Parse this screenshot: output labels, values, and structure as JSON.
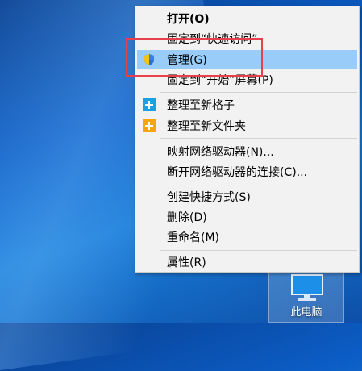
{
  "context_menu": {
    "items": [
      {
        "label": "打开(O)",
        "bold": true
      },
      {
        "label": "固定到“快速访问”"
      },
      {
        "label": "管理(G)",
        "icon": "shield-icon",
        "hovered": true
      },
      {
        "label": "固定到“开始”屏幕(P)"
      },
      {
        "label": "整理至新格子",
        "icon": "plus-tile-icon"
      },
      {
        "label": "整理至新文件夹",
        "icon": "plus-folder-icon"
      },
      {
        "label": "映射网络驱动器(N)..."
      },
      {
        "label": "断开网络驱动器的连接(C)..."
      },
      {
        "label": "创建快捷方式(S)"
      },
      {
        "label": "删除(D)"
      },
      {
        "label": "重命名(M)"
      },
      {
        "label": "属性(R)"
      }
    ]
  },
  "desktop": {
    "icon_label": "此电脑"
  },
  "colors": {
    "hover": "#99ccf8",
    "highlight_box": "#e8404a",
    "tile_icon": "#1ba1e2",
    "folder_icon": "#f7a50d"
  }
}
